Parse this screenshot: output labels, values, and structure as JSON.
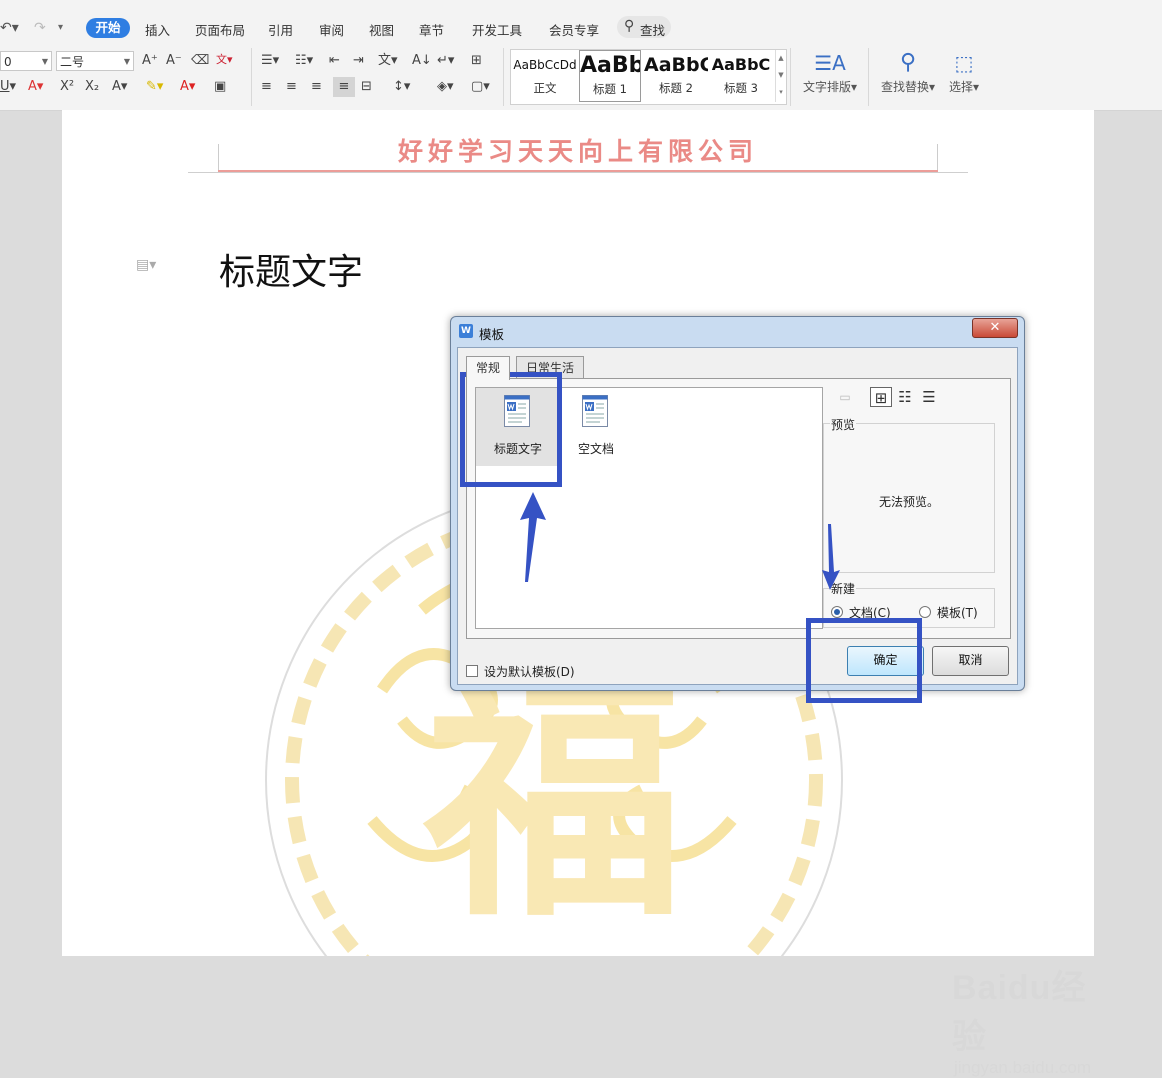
{
  "menubar": {
    "tabs": [
      "开始",
      "插入",
      "页面布局",
      "引用",
      "审阅",
      "视图",
      "章节",
      "开发工具",
      "会员专享"
    ],
    "search_label": "查找"
  },
  "ribbon": {
    "font_name": "0",
    "font_size": "二号",
    "styles": [
      {
        "preview": "AaBbCcDd",
        "name": "正文"
      },
      {
        "preview": "AaBb",
        "name": "标题 1"
      },
      {
        "preview": "AaBbC",
        "name": "标题 2"
      },
      {
        "preview": "AaBbC",
        "name": "标题 3"
      }
    ],
    "text_layout_label": "文字排版",
    "find_replace_label": "查找替换",
    "select_label": "选择"
  },
  "document": {
    "header_company": "好好学习天天向上有限公司",
    "title": "标题文字",
    "watermark_char": "福"
  },
  "dialog": {
    "title": "模板",
    "tabs": [
      "常规",
      "日常生活"
    ],
    "templates": [
      {
        "label": "标题文字",
        "selected": true
      },
      {
        "label": "空文档",
        "selected": false
      }
    ],
    "preview_label": "预览",
    "preview_text": "无法预览。",
    "new_group_label": "新建",
    "radio_document": "文档(C)",
    "radio_template": "模板(T)",
    "default_checkbox_label": "设为默认模板(D)",
    "ok_label": "确定",
    "cancel_label": "取消"
  },
  "watermark": {
    "brand": "Baidu经验",
    "url": "jingyan.baidu.com"
  },
  "colors": {
    "accent": "#2f7ee2",
    "highlight": "#3552c4",
    "header_text": "#ea8a86"
  }
}
